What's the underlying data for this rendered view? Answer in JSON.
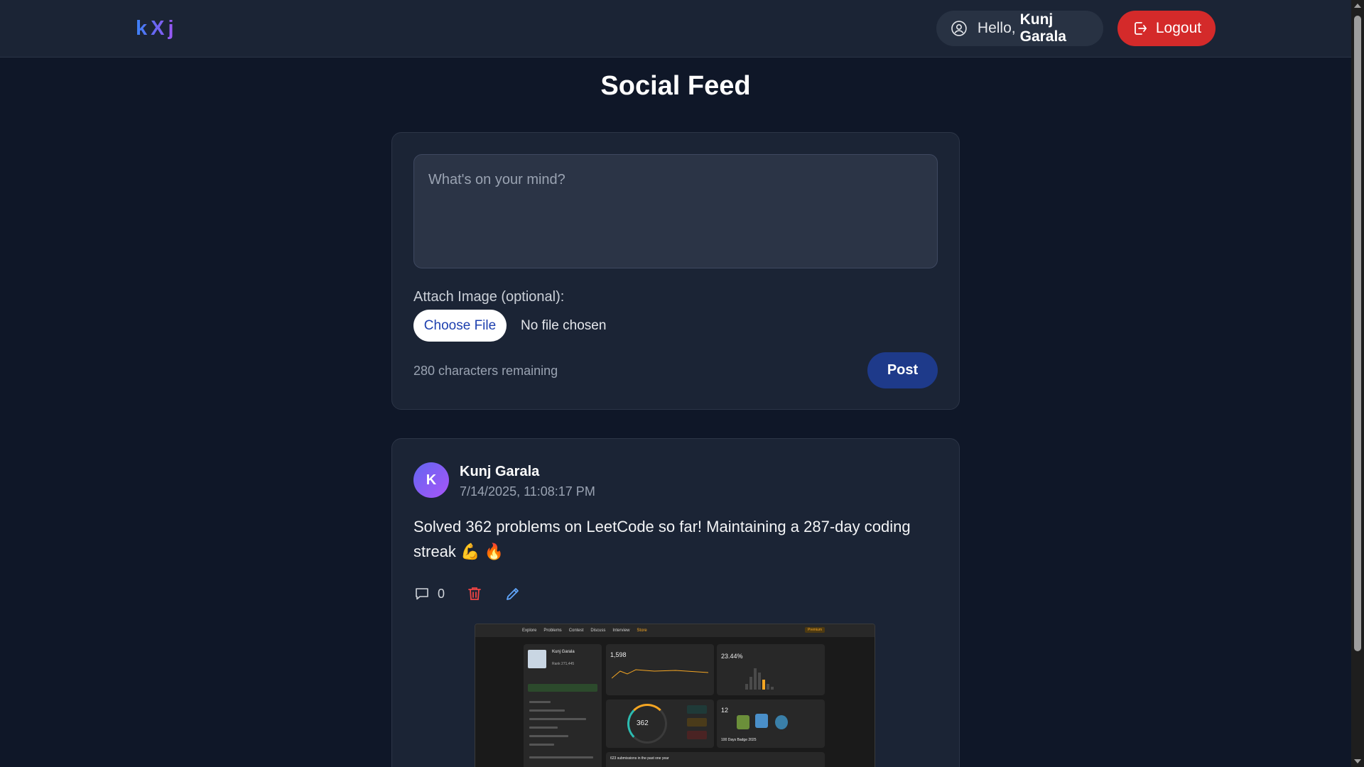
{
  "header": {
    "logo": "kXj",
    "greeting_prefix": "Hello,",
    "user_name": "Kunj Garala",
    "logout_label": "Logout"
  },
  "page": {
    "title": "Social Feed"
  },
  "composer": {
    "placeholder": "What's on your mind?",
    "attach_label": "Attach Image (optional):",
    "choose_file_label": "Choose File",
    "file_status": "No file chosen",
    "char_remaining": "280 characters remaining",
    "post_label": "Post"
  },
  "posts": [
    {
      "avatar_initial": "K",
      "author": "Kunj Garala",
      "timestamp": "7/14/2025, 11:08:17 PM",
      "text": "Solved 362 problems on LeetCode so far! Maintaining a 287-day coding streak 💪 🔥",
      "comment_count": "0",
      "attachment": {
        "nav": [
          "Explore",
          "Problems",
          "Contest",
          "Discuss",
          "Interview",
          "Store"
        ],
        "premium": "Premium",
        "profile_name": "Kunj Garala",
        "rank": "Rank 271,445",
        "contest_rating": "1,598",
        "top_percent": "23.44%",
        "solved": "362",
        "badges": "12",
        "badge_name": "100 Days Badge 2025",
        "submissions": "623 submissions in the past one year"
      }
    }
  ],
  "colors": {
    "background": "#0f1728",
    "card": "#1b2435",
    "logout": "#d42a2a",
    "post_button": "#1e3a8a",
    "delete_icon": "#ef4444",
    "edit_icon": "#60a5fa"
  }
}
